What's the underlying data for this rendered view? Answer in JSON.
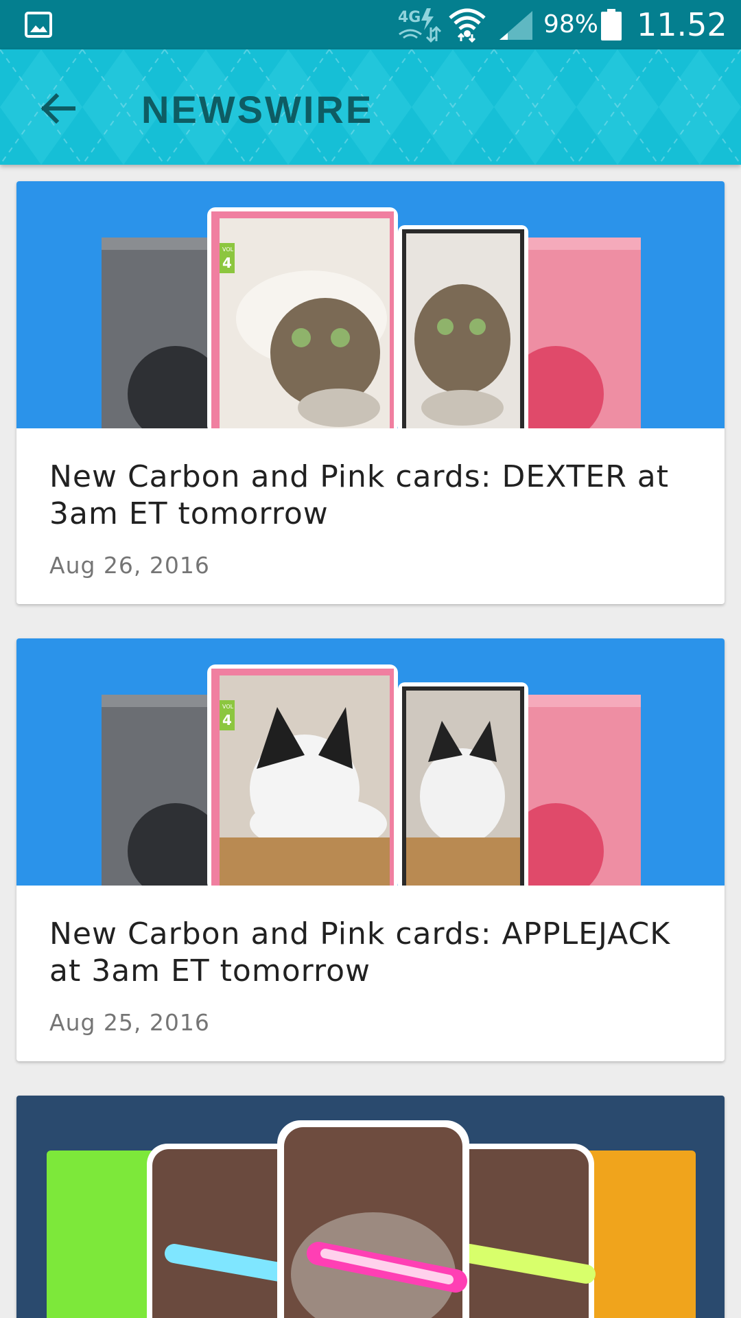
{
  "status_bar": {
    "network_label": "4G",
    "battery": "98%",
    "time": "11.52"
  },
  "app_bar": {
    "title": "NEWSWIRE"
  },
  "cards": [
    {
      "headline": "New Carbon and Pink cards: DEXTER at 3am ET tomorrow",
      "date": "Aug 26, 2016",
      "image_badge": "4",
      "image_badge_top": "VOL"
    },
    {
      "headline": "New Carbon and Pink cards: APPLEJACK at 3am ET tomorrow",
      "date": "Aug 25, 2016",
      "image_badge": "4",
      "image_badge_top": "VOL"
    },
    {
      "headline": "",
      "date": ""
    }
  ],
  "colors": {
    "status_bar": "#047f8f",
    "app_bar": "#16bfd6",
    "title": "#0e5c63",
    "hero_blue": "#2b93ea",
    "hero_navy": "#2a4a6e"
  }
}
